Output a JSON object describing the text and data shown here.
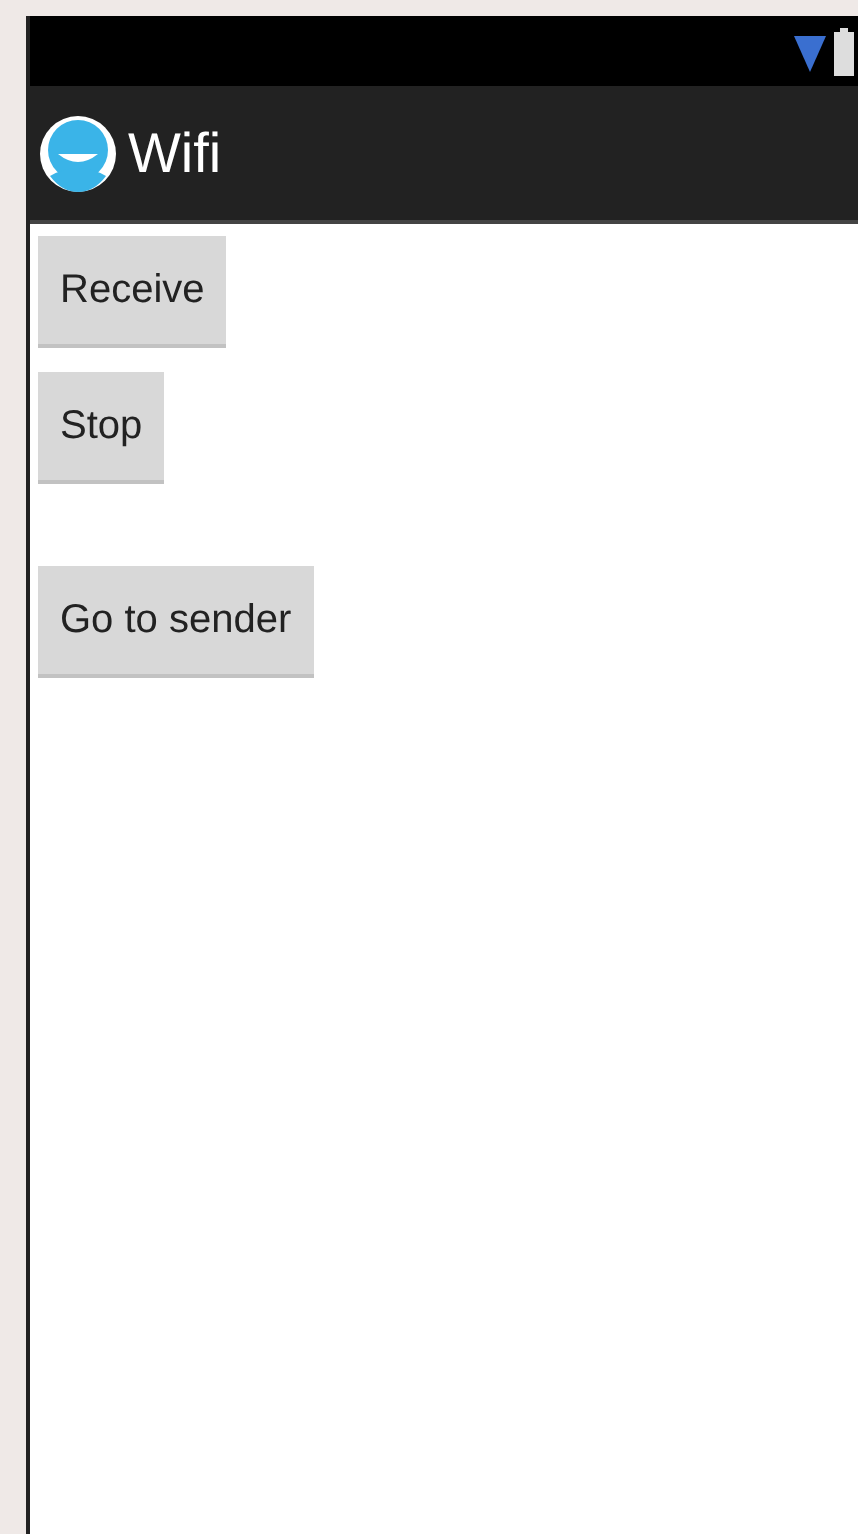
{
  "action_bar": {
    "title": "Wifi"
  },
  "buttons": [
    {
      "label": "Receive"
    },
    {
      "label": "Stop"
    },
    {
      "label": "Go to sender"
    }
  ]
}
